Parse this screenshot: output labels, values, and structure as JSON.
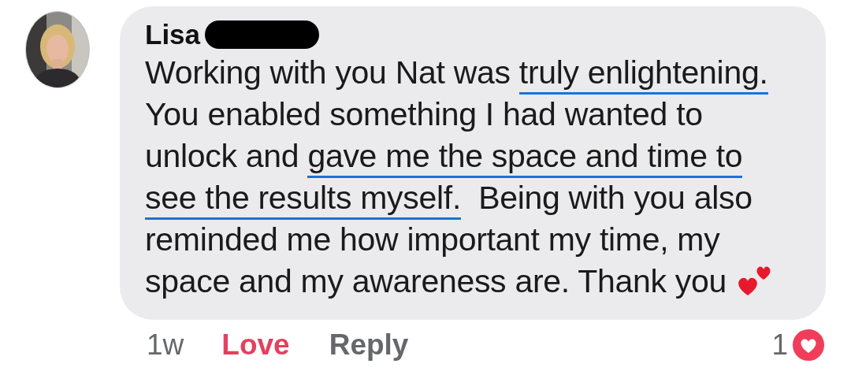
{
  "comment": {
    "author": "Lisa",
    "body": [
      {
        "text": "Working with you Nat was ",
        "underlined": false
      },
      {
        "text": "truly enlightening.",
        "underlined": true
      },
      {
        "text": "\nYou enabled something I had wanted to\nunlock and ",
        "underlined": false
      },
      {
        "text": "gave me the space and time to\nsee the results myself.",
        "underlined": true
      },
      {
        "text": "  Being with you also\nreminded me how important my time, my\nspace and my awareness are. Thank you ",
        "underlined": false
      }
    ],
    "time": "1w",
    "reaction_label": "Love",
    "reply_label": "Reply",
    "reaction_count": "1",
    "reacted": true
  }
}
